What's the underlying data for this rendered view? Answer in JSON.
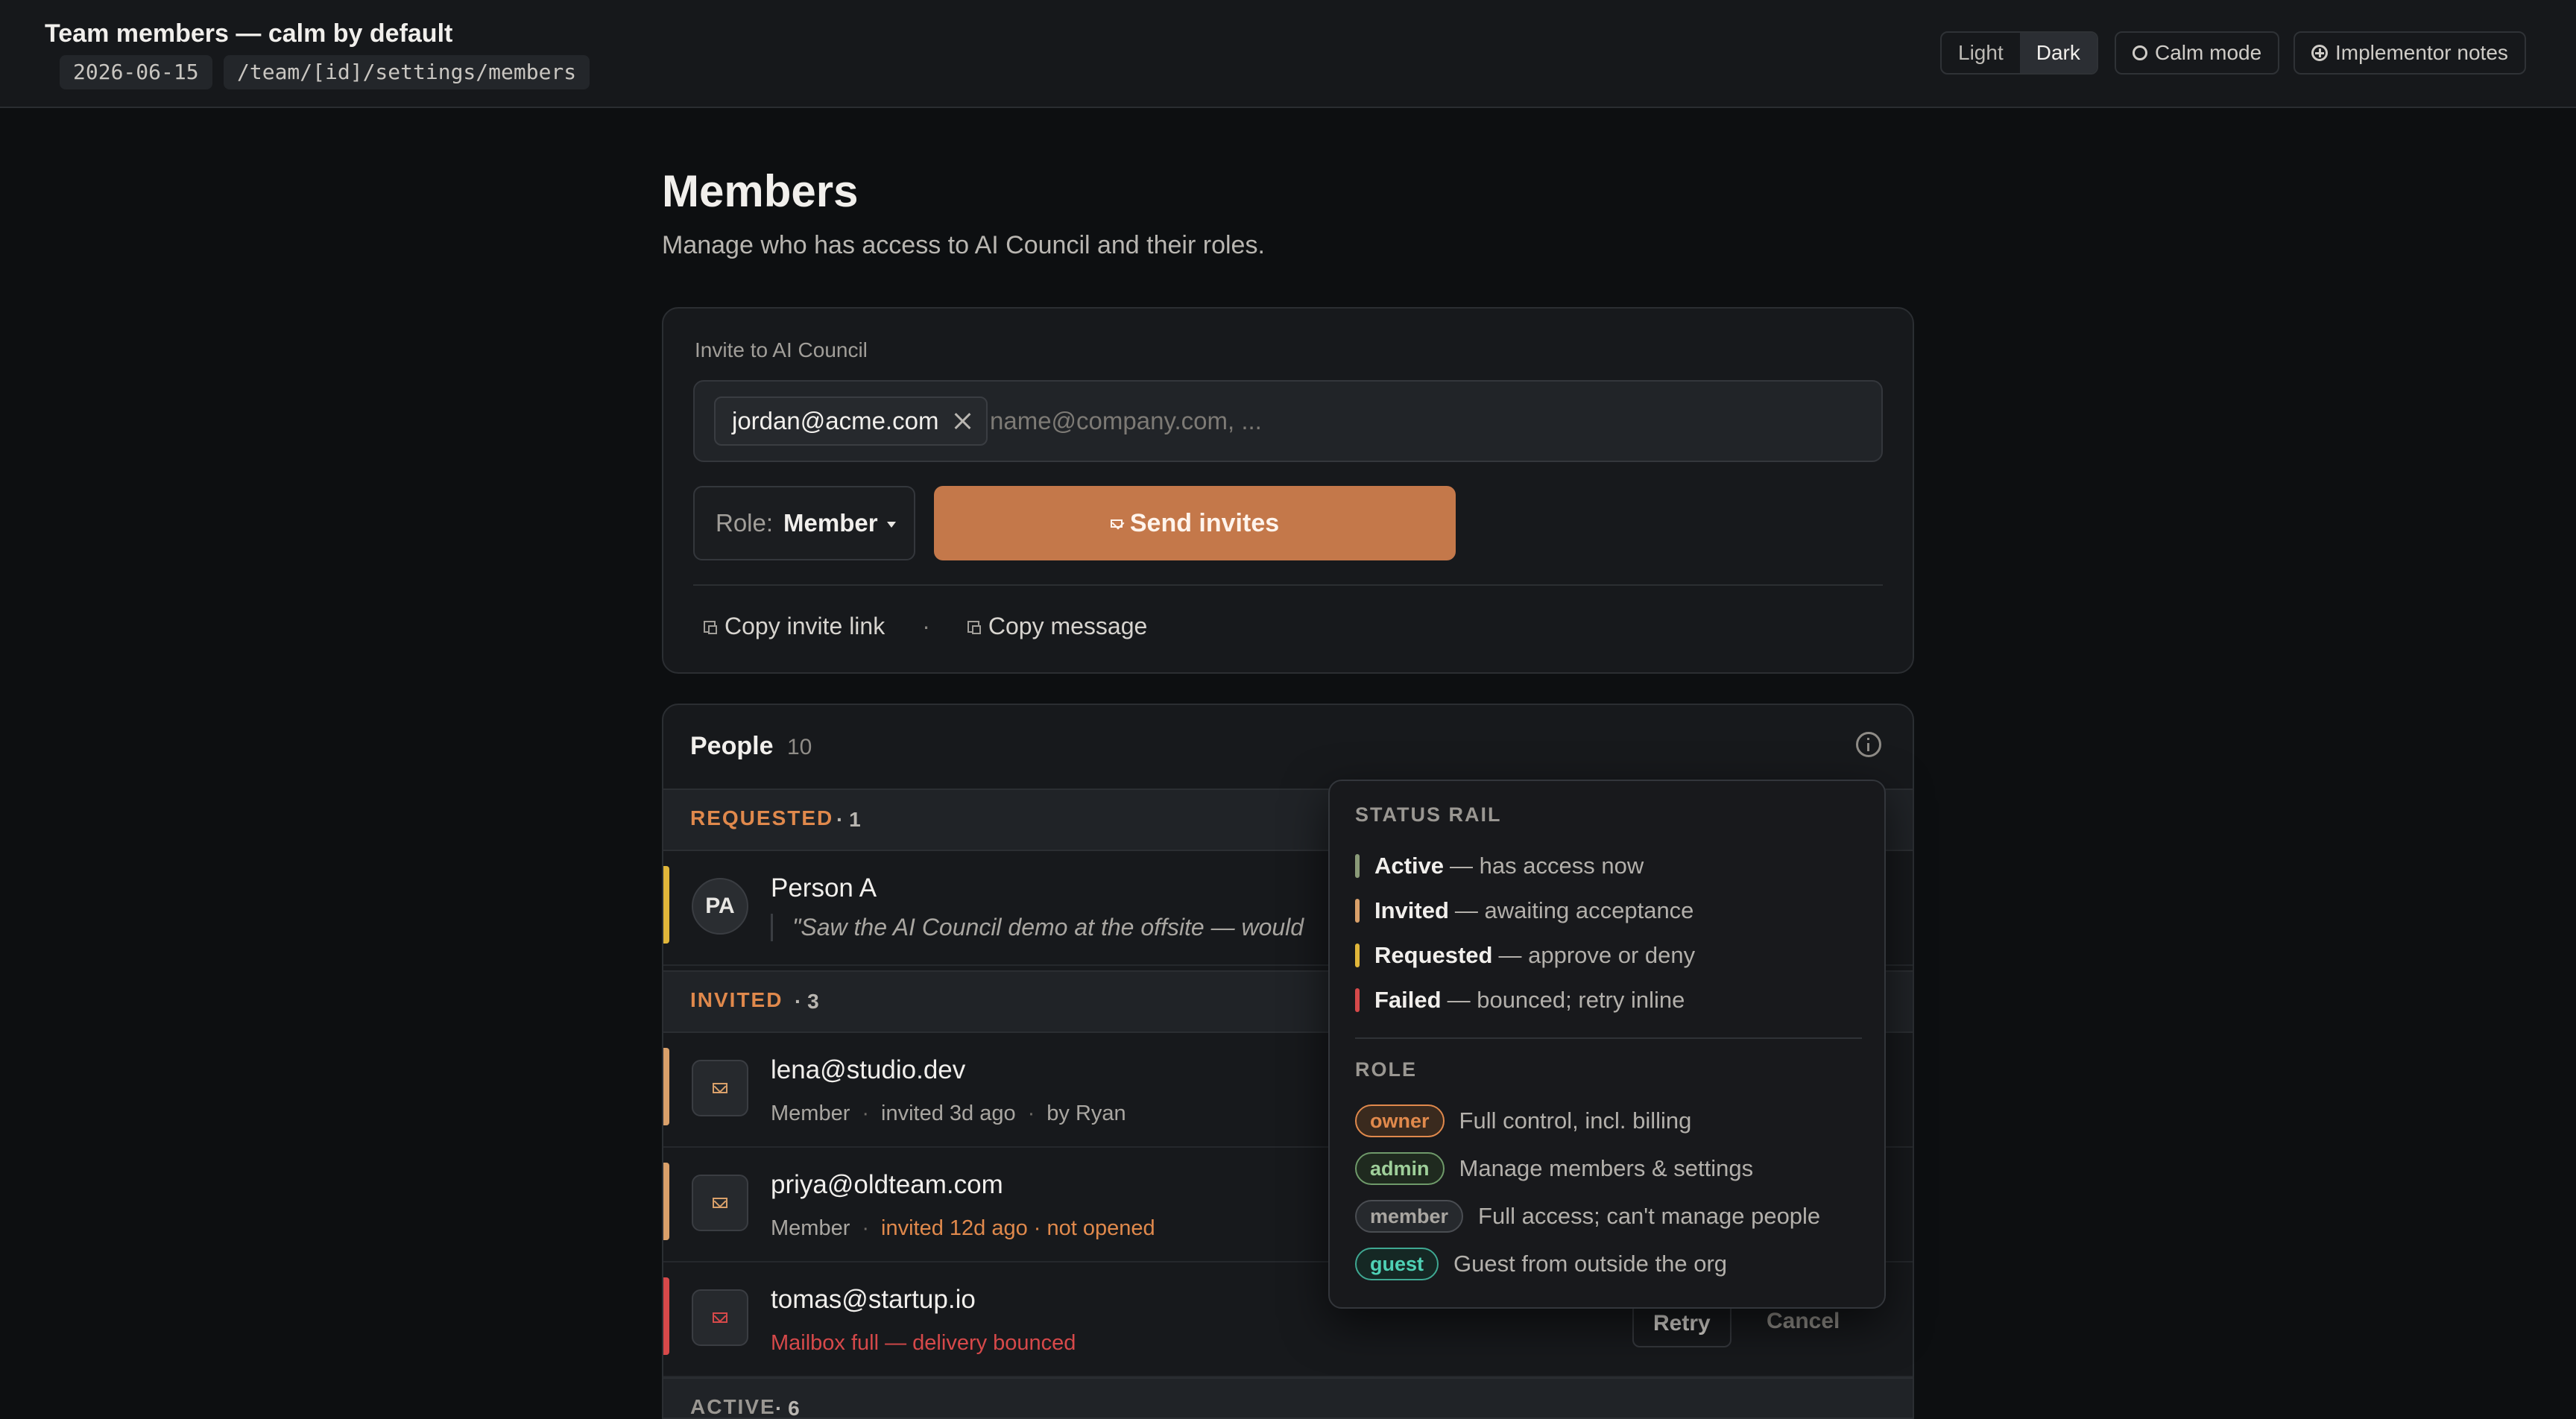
{
  "header": {
    "title": "Team members — calm by default",
    "date": "2026-06-15",
    "route": "/team/[id]/settings/members",
    "theme_light": "Light",
    "theme_dark": "Dark",
    "calm_mode": "Calm mode",
    "implementor_notes": "Implementor notes"
  },
  "page": {
    "title": "Members",
    "subtitle": "Manage who has access to AI Council and their roles."
  },
  "invite": {
    "label": "Invite to AI Council",
    "chip_email": "jordan@acme.com",
    "placeholder": "name@company.com, ...",
    "role_label": "Role:",
    "role_value": "Member",
    "send_label": "Send invites",
    "copy_link": "Copy invite link",
    "separator": "·",
    "copy_message": "Copy message"
  },
  "people": {
    "title": "People",
    "count": "10",
    "sections": {
      "requested": {
        "label": "REQUESTED",
        "count": "· 1"
      },
      "invited": {
        "label": "INVITED",
        "count": "· 3"
      },
      "active": {
        "label": "ACTIVE",
        "count": "· 6"
      }
    },
    "requested_row": {
      "initials": "PA",
      "name": "Person A",
      "quote": "\"Saw the AI Council demo at the offsite — would"
    },
    "invited_rows": [
      {
        "email": "lena@studio.dev",
        "role": "Member",
        "when": "invited 3d ago",
        "by": "by Ryan"
      },
      {
        "email": "priya@oldteam.com",
        "role": "Member",
        "when": "invited 12d ago · not opened"
      },
      {
        "email": "tomas@startup.io",
        "error": "Mailbox full — delivery bounced",
        "retry": "Retry",
        "cancel": "Cancel"
      }
    ]
  },
  "popover": {
    "status_title": "STATUS RAIL",
    "statuses": [
      {
        "name": "Active",
        "desc": "— has access now",
        "color": "#8a9a78"
      },
      {
        "name": "Invited",
        "desc": "— awaiting acceptance",
        "color": "#d9a06a"
      },
      {
        "name": "Requested",
        "desc": "— approve or deny",
        "color": "#e0b63a"
      },
      {
        "name": "Failed",
        "desc": "— bounced; retry inline",
        "color": "#d6494a"
      }
    ],
    "role_title": "ROLE",
    "roles": [
      {
        "name": "owner",
        "desc": "Full control, incl. billing",
        "color": "#e0894c"
      },
      {
        "name": "admin",
        "desc": "Manage members & settings",
        "color": "#9fcf9a"
      },
      {
        "name": "member",
        "desc": "Full access; can't manage people",
        "color": "#a9a6a1"
      },
      {
        "name": "guest",
        "desc": "Guest from outside the org",
        "color": "#4fd1b5"
      }
    ]
  },
  "colors": {
    "accent": "#c4784a",
    "requested": "#e0b63a",
    "invited": "#d9a06a",
    "failed": "#d6494a",
    "section_label": "#e0894c"
  }
}
